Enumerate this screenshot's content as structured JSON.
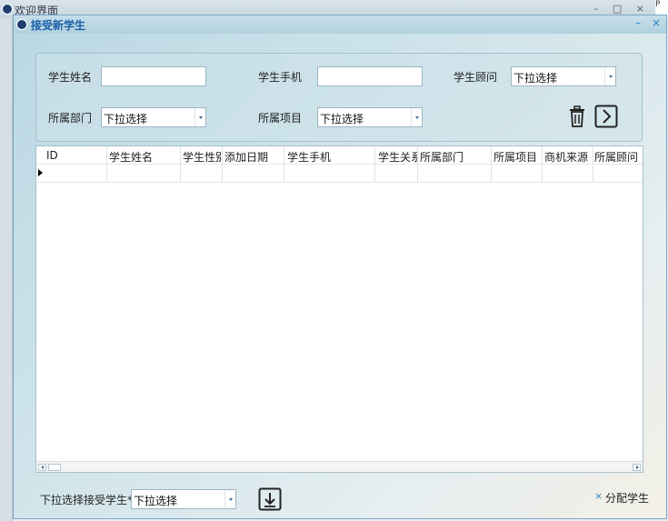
{
  "background_window": {
    "title": "欢迎界面",
    "controls": "– □ ×",
    "right_strip_text": "P"
  },
  "dialog": {
    "title": "接受新学生",
    "minimize": "–",
    "close": "×"
  },
  "filters": {
    "student_name_label": "学生姓名",
    "student_name_value": "",
    "student_phone_label": "学生手机",
    "student_phone_value": "",
    "advisor_label": "学生顾问",
    "advisor_value": "下拉选择",
    "department_label": "所属部门",
    "department_value": "下拉选择",
    "project_label": "所属项目",
    "project_value": "下拉选择"
  },
  "grid": {
    "columns": [
      "ID",
      "学生姓名",
      "学生性别",
      "添加日期",
      "学生手机",
      "学生关系",
      "所属部门",
      "所属项目",
      "商机来源",
      "所属顾问"
    ],
    "rows": []
  },
  "footer": {
    "assign_label": "下拉选择接受学生*",
    "assign_value": "下拉选择",
    "assign_student_label": "分配学生",
    "assign_student_icon": "×"
  },
  "icons": {
    "delete": "trash-icon",
    "next": "chevron-right-icon",
    "download": "download-icon"
  },
  "colors": {
    "title_blue": "#1a5fa8",
    "accent_blue": "#2a86c8"
  }
}
